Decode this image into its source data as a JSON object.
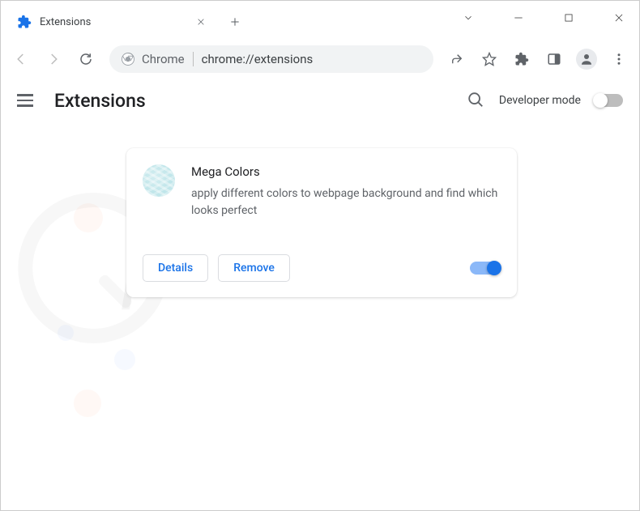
{
  "window": {
    "tab_title": "Extensions"
  },
  "omnibox": {
    "scheme_label": "Chrome",
    "url": "chrome://extensions"
  },
  "page": {
    "title": "Extensions",
    "dev_mode_label": "Developer mode"
  },
  "extension": {
    "name": "Mega Colors",
    "description": "apply different colors to webpage background and find which looks perfect",
    "details_label": "Details",
    "remove_label": "Remove"
  }
}
